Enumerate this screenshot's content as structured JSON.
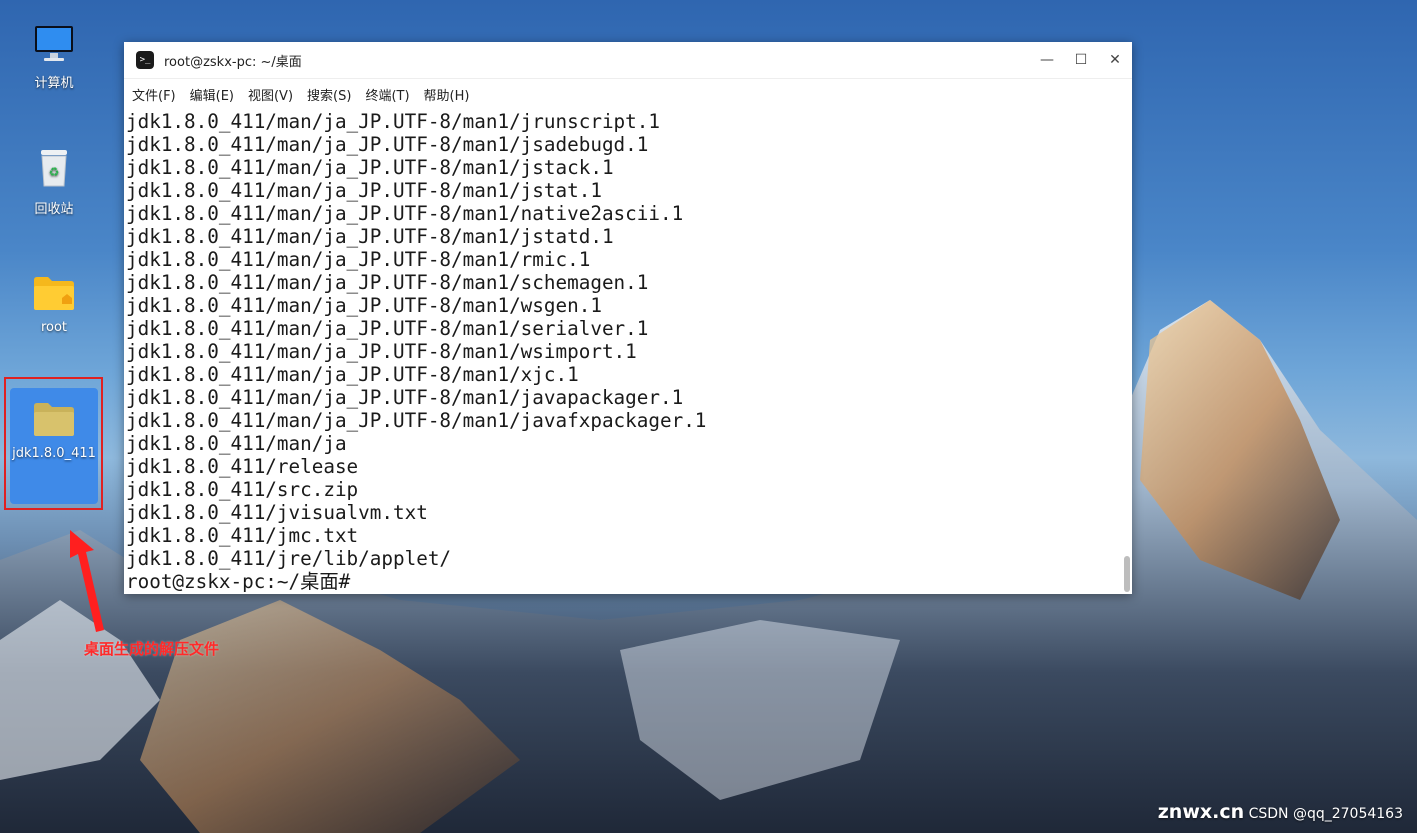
{
  "desktop": {
    "icons": [
      {
        "label": "计算机"
      },
      {
        "label": "回收站"
      },
      {
        "label": "root"
      },
      {
        "label": "jdk1.8.0_411"
      }
    ],
    "annotation": "桌面生成的解压文件"
  },
  "window": {
    "title": "root@zskx-pc: ~/桌面",
    "menu": [
      "文件(F)",
      "编辑(E)",
      "视图(V)",
      "搜索(S)",
      "终端(T)",
      "帮助(H)"
    ],
    "lines": [
      "jdk1.8.0_411/man/ja_JP.UTF-8/man1/jrunscript.1",
      "jdk1.8.0_411/man/ja_JP.UTF-8/man1/jsadebugd.1",
      "jdk1.8.0_411/man/ja_JP.UTF-8/man1/jstack.1",
      "jdk1.8.0_411/man/ja_JP.UTF-8/man1/jstat.1",
      "jdk1.8.0_411/man/ja_JP.UTF-8/man1/native2ascii.1",
      "jdk1.8.0_411/man/ja_JP.UTF-8/man1/jstatd.1",
      "jdk1.8.0_411/man/ja_JP.UTF-8/man1/rmic.1",
      "jdk1.8.0_411/man/ja_JP.UTF-8/man1/schemagen.1",
      "jdk1.8.0_411/man/ja_JP.UTF-8/man1/wsgen.1",
      "jdk1.8.0_411/man/ja_JP.UTF-8/man1/serialver.1",
      "jdk1.8.0_411/man/ja_JP.UTF-8/man1/wsimport.1",
      "jdk1.8.0_411/man/ja_JP.UTF-8/man1/xjc.1",
      "jdk1.8.0_411/man/ja_JP.UTF-8/man1/javapackager.1",
      "jdk1.8.0_411/man/ja_JP.UTF-8/man1/javafxpackager.1",
      "jdk1.8.0_411/man/ja",
      "jdk1.8.0_411/release",
      "jdk1.8.0_411/src.zip",
      "jdk1.8.0_411/jvisualvm.txt",
      "jdk1.8.0_411/jmc.txt",
      "jdk1.8.0_411/jre/lib/applet/",
      "root@zskx-pc:~/桌面#"
    ]
  },
  "watermark": {
    "csdn": "CSDN @qq_27054163",
    "site": "znwx.cn"
  }
}
